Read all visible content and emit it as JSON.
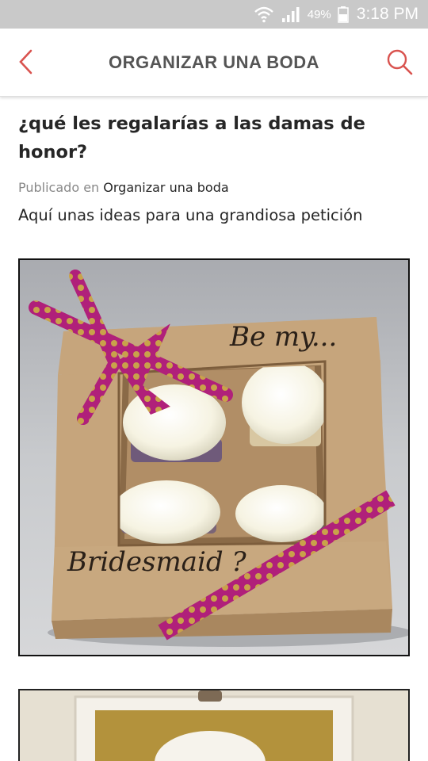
{
  "status_bar": {
    "battery": "49%",
    "time": "3:18 PM",
    "icons": [
      "wifi-icon",
      "signal-icon",
      "battery-icon"
    ]
  },
  "header": {
    "title": "ORGANIZAR UNA BODA",
    "back_icon": "chevron-left-icon",
    "search_icon": "search-icon",
    "accent_color": "#d9534f"
  },
  "article": {
    "title": "¿qué les regalarías a las damas de honor?",
    "meta_prefix": "Publicado en",
    "category": "Organizar una boda",
    "lede": "Aquí unas ideas para una grandiosa petición"
  },
  "photo": {
    "text_top": "Be my...",
    "text_bottom": "Bridesmaid ?"
  }
}
